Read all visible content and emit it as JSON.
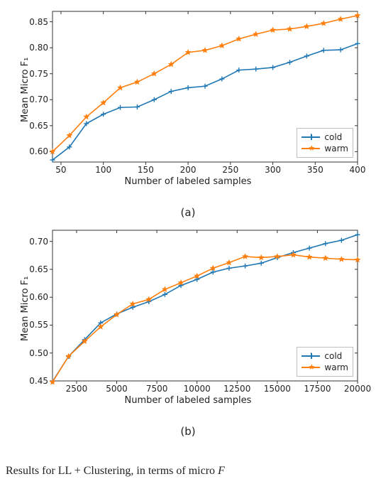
{
  "chart_data": [
    {
      "id": "a",
      "type": "line",
      "caption": "(a)",
      "xlabel": "Number of labeled samples",
      "ylabel": "Mean Micro F₁",
      "xlim": [
        40,
        400
      ],
      "ylim": [
        0.58,
        0.87
      ],
      "xticks": [
        50,
        100,
        150,
        200,
        250,
        300,
        350,
        400
      ],
      "yticks": [
        0.6,
        0.65,
        0.7,
        0.75,
        0.8,
        0.85
      ],
      "x": [
        40,
        60,
        80,
        100,
        120,
        140,
        160,
        180,
        200,
        220,
        240,
        260,
        280,
        300,
        320,
        340,
        360,
        380,
        400
      ],
      "series": [
        {
          "name": "cold",
          "color": "#1f77b4",
          "marker": "plus",
          "values": [
            0.584,
            0.609,
            0.654,
            0.672,
            0.685,
            0.686,
            0.7,
            0.716,
            0.723,
            0.726,
            0.74,
            0.757,
            0.759,
            0.762,
            0.772,
            0.784,
            0.795,
            0.796,
            0.808
          ]
        },
        {
          "name": "warm",
          "color": "#ff7f0e",
          "marker": "star",
          "values": [
            0.6,
            0.631,
            0.667,
            0.694,
            0.723,
            0.734,
            0.75,
            0.768,
            0.791,
            0.795,
            0.804,
            0.817,
            0.826,
            0.834,
            0.836,
            0.841,
            0.847,
            0.855,
            0.862
          ]
        }
      ],
      "legend": {
        "items": [
          "cold",
          "warm"
        ],
        "loc": "lower right"
      }
    },
    {
      "id": "b",
      "type": "line",
      "caption": "(b)",
      "xlabel": "Number of labeled samples",
      "ylabel": "Mean Micro F₁",
      "xlim": [
        1000,
        20000
      ],
      "ylim": [
        0.45,
        0.72
      ],
      "xticks": [
        2500,
        5000,
        7500,
        10000,
        12500,
        15000,
        17500,
        20000
      ],
      "yticks": [
        0.45,
        0.5,
        0.55,
        0.6,
        0.65,
        0.7
      ],
      "x": [
        1000,
        2000,
        3000,
        4000,
        5000,
        6000,
        7000,
        8000,
        9000,
        10000,
        11000,
        12000,
        13000,
        14000,
        15000,
        16000,
        17000,
        18000,
        19000,
        20000
      ],
      "series": [
        {
          "name": "cold",
          "color": "#1f77b4",
          "marker": "plus",
          "values": [
            0.449,
            0.494,
            0.524,
            0.554,
            0.57,
            0.582,
            0.592,
            0.605,
            0.621,
            0.632,
            0.645,
            0.652,
            0.656,
            0.661,
            0.671,
            0.68,
            0.688,
            0.696,
            0.702,
            0.712
          ]
        },
        {
          "name": "warm",
          "color": "#ff7f0e",
          "marker": "star",
          "values": [
            0.448,
            0.494,
            0.521,
            0.547,
            0.569,
            0.588,
            0.596,
            0.614,
            0.626,
            0.638,
            0.652,
            0.662,
            0.673,
            0.671,
            0.673,
            0.676,
            0.672,
            0.67,
            0.668,
            0.667
          ]
        }
      ],
      "legend": {
        "items": [
          "cold",
          "warm"
        ],
        "loc": "lower right"
      }
    }
  ],
  "footer_text": {
    "before_italic": "Results for LL + Clustering, in terms of micro ",
    "italic": "F"
  }
}
